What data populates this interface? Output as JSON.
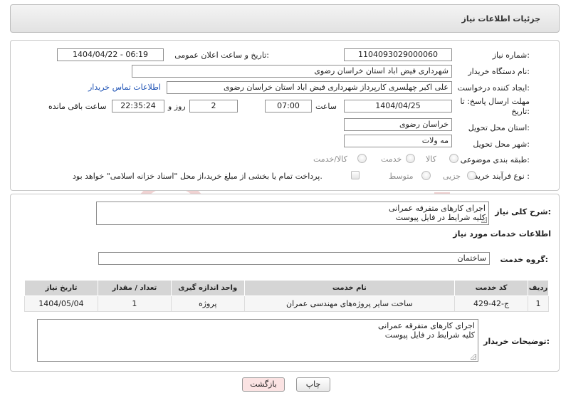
{
  "header": {
    "title": "جزئیات اطلاعات نیاز"
  },
  "form": {
    "need_number_label": "شماره نیاز:",
    "need_number": "1104093029000060",
    "announce_label": "تاریخ و ساعت اعلان عمومی:",
    "announce_value": "1404/04/22 - 06:19",
    "buyer_org_label": "نام دستگاه خریدار:",
    "buyer_org": "شهرداری فیض اباد استان خراسان رضوی",
    "creator_label": "ایجاد کننده درخواست:",
    "creator": "علی اکبر چهلسری کارپرداز شهرداری فیض اباد استان خراسان رضوی",
    "contact_link": "اطلاعات تماس خریدار",
    "deadline_label": "مهلت ارسال پاسخ: تا تاریخ:",
    "deadline_date": "1404/04/25",
    "time_label": "ساعت",
    "deadline_time": "07:00",
    "days_value": "2",
    "days_label": "روز و",
    "remaining_time": "22:35:24",
    "remaining_label": "ساعت باقی مانده",
    "province_label": "استان محل تحویل:",
    "province": "خراسان رضوی",
    "city_label": "شهر محل تحویل:",
    "city": "مه ولات",
    "category_label": "طبقه بندی موضوعی:",
    "category_options": [
      "کالا",
      "خدمت",
      "کالا/خدمت"
    ],
    "process_label": "نوع فرآیند خرید :",
    "process_options": [
      "جزیی",
      "متوسط"
    ],
    "payment_text": "پرداخت تمام یا بخشی از مبلغ خرید،از محل \"اسناد خزانه اسلامی\" خواهد بود."
  },
  "description": {
    "label": "شرح کلی نیاز:",
    "text": "اجرای کارهای متفرقه عمرانی\nکلیه شرایط در فایل پیوست"
  },
  "services": {
    "section_title": "اطلاعات خدمات مورد نیاز",
    "group_label": "گروه خدمت:",
    "group_value": "ساختمان",
    "columns": [
      "ردیف",
      "کد خدمت",
      "نام خدمت",
      "واحد اندازه گیری",
      "تعداد / مقدار",
      "تاریخ نیاز"
    ],
    "rows": [
      [
        "1",
        "ج-42-429",
        "ساخت سایر پروژه‌های مهندسی عمران",
        "پروژه",
        "1",
        "1404/05/04"
      ]
    ]
  },
  "buyer_notes": {
    "label": "توضیحات خریدار:",
    "text": "اجرای کارهای متفرقه عمرانی\nکلیه شرایط در فایل پیوست"
  },
  "buttons": {
    "print": "چاپ",
    "back": "بازگشت"
  },
  "colors": {
    "link": "#1a4fb3",
    "back_button_bg": "#fbe3e3",
    "table_header": "#d5d5d5"
  }
}
